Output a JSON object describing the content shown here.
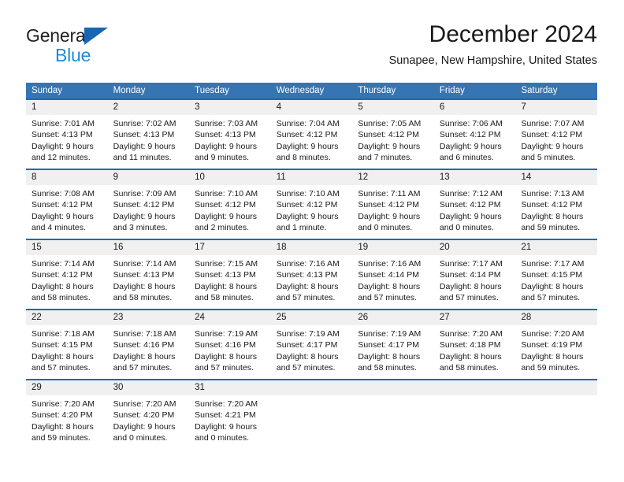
{
  "brand": {
    "name_top": "General",
    "name_bottom": "Blue",
    "triangle_color": "#1667b2",
    "blue_text_color": "#1e8bd6"
  },
  "header": {
    "title": "December 2024",
    "subtitle": "Sunapee, New Hampshire, United States"
  },
  "theme": {
    "header_row_bg": "#3575b4",
    "week_separator": "#1f69ad",
    "daynum_bg": "#f0f0f0",
    "text": "#1a1a1a"
  },
  "weekdays": [
    "Sunday",
    "Monday",
    "Tuesday",
    "Wednesday",
    "Thursday",
    "Friday",
    "Saturday"
  ],
  "weeks": [
    {
      "days": [
        {
          "num": "1",
          "sunrise": "Sunrise: 7:01 AM",
          "sunset": "Sunset: 4:13 PM",
          "daylight1": "Daylight: 9 hours",
          "daylight2": "and 12 minutes."
        },
        {
          "num": "2",
          "sunrise": "Sunrise: 7:02 AM",
          "sunset": "Sunset: 4:13 PM",
          "daylight1": "Daylight: 9 hours",
          "daylight2": "and 11 minutes."
        },
        {
          "num": "3",
          "sunrise": "Sunrise: 7:03 AM",
          "sunset": "Sunset: 4:13 PM",
          "daylight1": "Daylight: 9 hours",
          "daylight2": "and 9 minutes."
        },
        {
          "num": "4",
          "sunrise": "Sunrise: 7:04 AM",
          "sunset": "Sunset: 4:12 PM",
          "daylight1": "Daylight: 9 hours",
          "daylight2": "and 8 minutes."
        },
        {
          "num": "5",
          "sunrise": "Sunrise: 7:05 AM",
          "sunset": "Sunset: 4:12 PM",
          "daylight1": "Daylight: 9 hours",
          "daylight2": "and 7 minutes."
        },
        {
          "num": "6",
          "sunrise": "Sunrise: 7:06 AM",
          "sunset": "Sunset: 4:12 PM",
          "daylight1": "Daylight: 9 hours",
          "daylight2": "and 6 minutes."
        },
        {
          "num": "7",
          "sunrise": "Sunrise: 7:07 AM",
          "sunset": "Sunset: 4:12 PM",
          "daylight1": "Daylight: 9 hours",
          "daylight2": "and 5 minutes."
        }
      ]
    },
    {
      "days": [
        {
          "num": "8",
          "sunrise": "Sunrise: 7:08 AM",
          "sunset": "Sunset: 4:12 PM",
          "daylight1": "Daylight: 9 hours",
          "daylight2": "and 4 minutes."
        },
        {
          "num": "9",
          "sunrise": "Sunrise: 7:09 AM",
          "sunset": "Sunset: 4:12 PM",
          "daylight1": "Daylight: 9 hours",
          "daylight2": "and 3 minutes."
        },
        {
          "num": "10",
          "sunrise": "Sunrise: 7:10 AM",
          "sunset": "Sunset: 4:12 PM",
          "daylight1": "Daylight: 9 hours",
          "daylight2": "and 2 minutes."
        },
        {
          "num": "11",
          "sunrise": "Sunrise: 7:10 AM",
          "sunset": "Sunset: 4:12 PM",
          "daylight1": "Daylight: 9 hours",
          "daylight2": "and 1 minute."
        },
        {
          "num": "12",
          "sunrise": "Sunrise: 7:11 AM",
          "sunset": "Sunset: 4:12 PM",
          "daylight1": "Daylight: 9 hours",
          "daylight2": "and 0 minutes."
        },
        {
          "num": "13",
          "sunrise": "Sunrise: 7:12 AM",
          "sunset": "Sunset: 4:12 PM",
          "daylight1": "Daylight: 9 hours",
          "daylight2": "and 0 minutes."
        },
        {
          "num": "14",
          "sunrise": "Sunrise: 7:13 AM",
          "sunset": "Sunset: 4:12 PM",
          "daylight1": "Daylight: 8 hours",
          "daylight2": "and 59 minutes."
        }
      ]
    },
    {
      "days": [
        {
          "num": "15",
          "sunrise": "Sunrise: 7:14 AM",
          "sunset": "Sunset: 4:12 PM",
          "daylight1": "Daylight: 8 hours",
          "daylight2": "and 58 minutes."
        },
        {
          "num": "16",
          "sunrise": "Sunrise: 7:14 AM",
          "sunset": "Sunset: 4:13 PM",
          "daylight1": "Daylight: 8 hours",
          "daylight2": "and 58 minutes."
        },
        {
          "num": "17",
          "sunrise": "Sunrise: 7:15 AM",
          "sunset": "Sunset: 4:13 PM",
          "daylight1": "Daylight: 8 hours",
          "daylight2": "and 58 minutes."
        },
        {
          "num": "18",
          "sunrise": "Sunrise: 7:16 AM",
          "sunset": "Sunset: 4:13 PM",
          "daylight1": "Daylight: 8 hours",
          "daylight2": "and 57 minutes."
        },
        {
          "num": "19",
          "sunrise": "Sunrise: 7:16 AM",
          "sunset": "Sunset: 4:14 PM",
          "daylight1": "Daylight: 8 hours",
          "daylight2": "and 57 minutes."
        },
        {
          "num": "20",
          "sunrise": "Sunrise: 7:17 AM",
          "sunset": "Sunset: 4:14 PM",
          "daylight1": "Daylight: 8 hours",
          "daylight2": "and 57 minutes."
        },
        {
          "num": "21",
          "sunrise": "Sunrise: 7:17 AM",
          "sunset": "Sunset: 4:15 PM",
          "daylight1": "Daylight: 8 hours",
          "daylight2": "and 57 minutes."
        }
      ]
    },
    {
      "days": [
        {
          "num": "22",
          "sunrise": "Sunrise: 7:18 AM",
          "sunset": "Sunset: 4:15 PM",
          "daylight1": "Daylight: 8 hours",
          "daylight2": "and 57 minutes."
        },
        {
          "num": "23",
          "sunrise": "Sunrise: 7:18 AM",
          "sunset": "Sunset: 4:16 PM",
          "daylight1": "Daylight: 8 hours",
          "daylight2": "and 57 minutes."
        },
        {
          "num": "24",
          "sunrise": "Sunrise: 7:19 AM",
          "sunset": "Sunset: 4:16 PM",
          "daylight1": "Daylight: 8 hours",
          "daylight2": "and 57 minutes."
        },
        {
          "num": "25",
          "sunrise": "Sunrise: 7:19 AM",
          "sunset": "Sunset: 4:17 PM",
          "daylight1": "Daylight: 8 hours",
          "daylight2": "and 57 minutes."
        },
        {
          "num": "26",
          "sunrise": "Sunrise: 7:19 AM",
          "sunset": "Sunset: 4:17 PM",
          "daylight1": "Daylight: 8 hours",
          "daylight2": "and 58 minutes."
        },
        {
          "num": "27",
          "sunrise": "Sunrise: 7:20 AM",
          "sunset": "Sunset: 4:18 PM",
          "daylight1": "Daylight: 8 hours",
          "daylight2": "and 58 minutes."
        },
        {
          "num": "28",
          "sunrise": "Sunrise: 7:20 AM",
          "sunset": "Sunset: 4:19 PM",
          "daylight1": "Daylight: 8 hours",
          "daylight2": "and 59 minutes."
        }
      ]
    },
    {
      "days": [
        {
          "num": "29",
          "sunrise": "Sunrise: 7:20 AM",
          "sunset": "Sunset: 4:20 PM",
          "daylight1": "Daylight: 8 hours",
          "daylight2": "and 59 minutes."
        },
        {
          "num": "30",
          "sunrise": "Sunrise: 7:20 AM",
          "sunset": "Sunset: 4:20 PM",
          "daylight1": "Daylight: 9 hours",
          "daylight2": "and 0 minutes."
        },
        {
          "num": "31",
          "sunrise": "Sunrise: 7:20 AM",
          "sunset": "Sunset: 4:21 PM",
          "daylight1": "Daylight: 9 hours",
          "daylight2": "and 0 minutes."
        },
        {
          "num": "",
          "sunrise": "",
          "sunset": "",
          "daylight1": "",
          "daylight2": ""
        },
        {
          "num": "",
          "sunrise": "",
          "sunset": "",
          "daylight1": "",
          "daylight2": ""
        },
        {
          "num": "",
          "sunrise": "",
          "sunset": "",
          "daylight1": "",
          "daylight2": ""
        },
        {
          "num": "",
          "sunrise": "",
          "sunset": "",
          "daylight1": "",
          "daylight2": ""
        }
      ]
    }
  ]
}
